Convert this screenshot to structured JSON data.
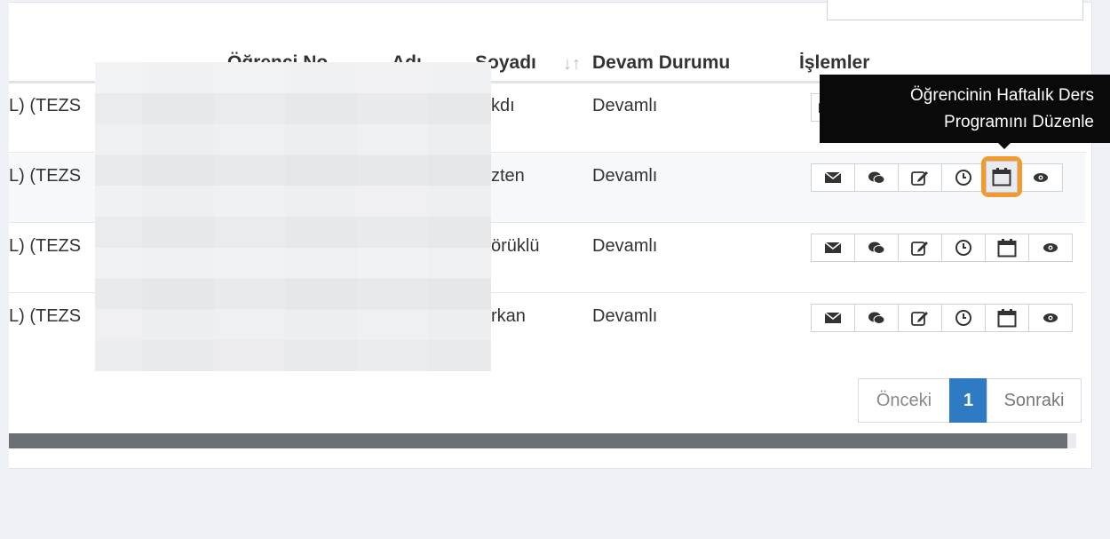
{
  "table": {
    "headers": {
      "student_no": "Öğrenci No",
      "first_name": "Adı",
      "last_name": "Soyadı",
      "status": "Devam Durumu",
      "actions": "İşlemler"
    },
    "rows": [
      {
        "program": "L) (TEZS",
        "last_name": "kdı",
        "status": "Devamlı"
      },
      {
        "program": "L) (TEZS",
        "last_name": "zten",
        "status": "Devamlı"
      },
      {
        "program": "L) (TEZS",
        "last_name": "örüklü",
        "status": "Devamlı"
      },
      {
        "program": "L) (TEZS",
        "last_name": "rkan",
        "status": "Devamlı"
      }
    ],
    "action_icons": [
      "envelope-icon",
      "chat-icon",
      "edit-icon",
      "clock-icon",
      "calendar-icon",
      "eye-icon"
    ]
  },
  "tooltip": {
    "line1": "Öğrencinin Haftalık Ders",
    "line2": "Programını Düzenle"
  },
  "pagination": {
    "prev": "Önceki",
    "current": "1",
    "next": "Sonraki"
  },
  "colors": {
    "highlight": "#f39a2f",
    "page_active": "#2e7bc4",
    "tooltip_bg": "#0a0a0a"
  }
}
